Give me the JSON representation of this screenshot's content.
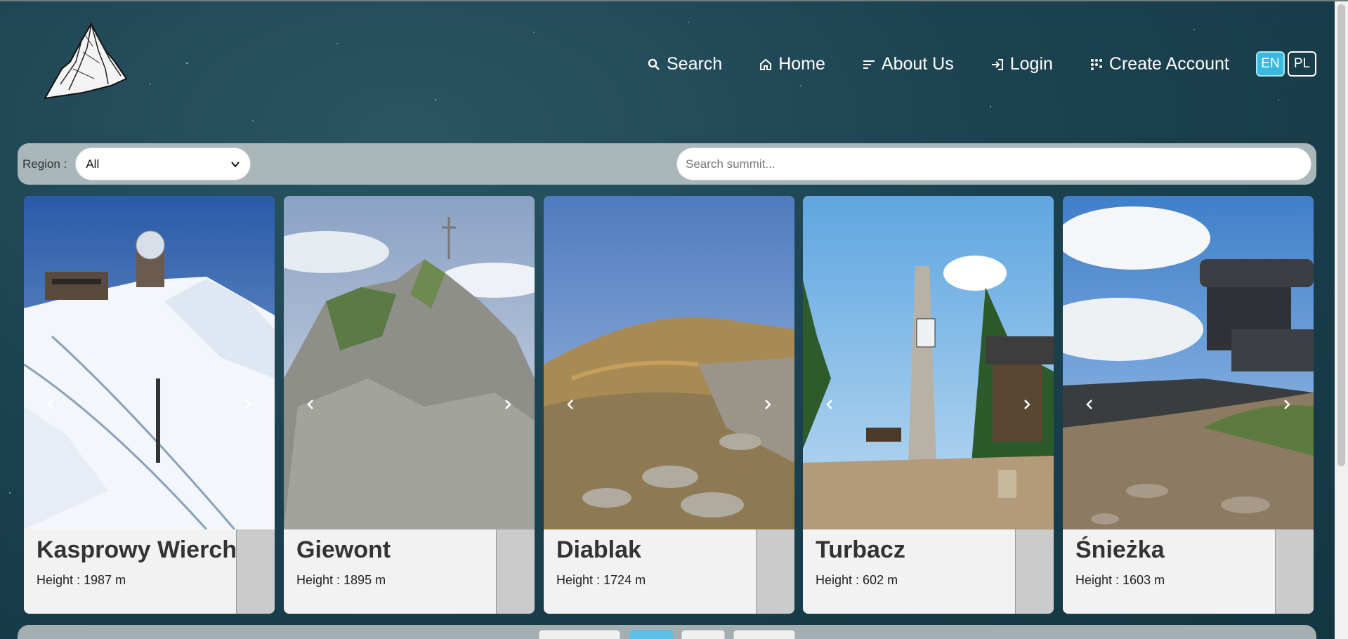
{
  "nav": {
    "search": "Search",
    "home": "Home",
    "about": "About Us",
    "login": "Login",
    "create": "Create Account"
  },
  "lang": {
    "en": "EN",
    "pl": "PL"
  },
  "filter": {
    "region_label": "Region :",
    "region_value": "All",
    "search_placeholder": "Search summit..."
  },
  "cards": [
    {
      "name": "Kasprowy Wierch",
      "height": "Height : 1987 m"
    },
    {
      "name": "Giewont",
      "height": "Height : 1895 m"
    },
    {
      "name": "Diablak",
      "height": "Height : 1724 m"
    },
    {
      "name": "Turbacz",
      "height": "Height : 602 m"
    },
    {
      "name": "Śnieżka",
      "height": "Height : 1603 m"
    }
  ],
  "colors": {
    "accent": "#39b8e0",
    "background": "#1c4250",
    "filter_bar": "#a9b7bb"
  }
}
